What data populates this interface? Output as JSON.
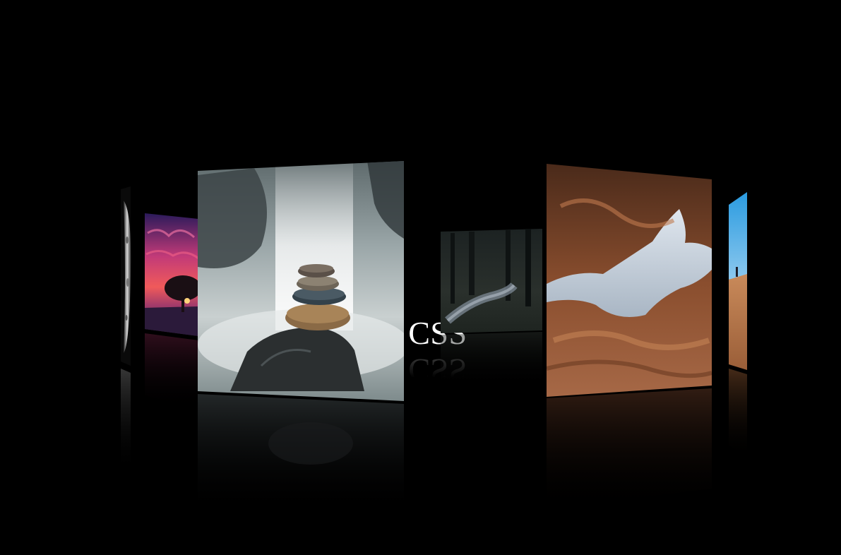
{
  "heading": "re CSS",
  "carousel": {
    "panels": [
      {
        "name": "moon",
        "subject": "moon-surface"
      },
      {
        "name": "sunset",
        "subject": "tree-at-sunset"
      },
      {
        "name": "stones",
        "subject": "stacked-stones-waterfall"
      },
      {
        "name": "forest",
        "subject": "forest-path"
      },
      {
        "name": "canyon",
        "subject": "red-sandstone-canyon"
      },
      {
        "name": "desert",
        "subject": "desert-walker"
      }
    ]
  },
  "colors": {
    "background": "#000000",
    "text": "#ffffff"
  }
}
